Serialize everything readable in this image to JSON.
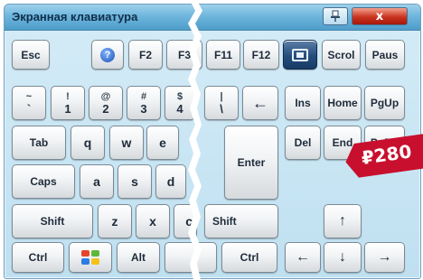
{
  "window": {
    "title": "Экранная клавиатура"
  },
  "titlebar": {
    "close_glyph": "x"
  },
  "keys": {
    "row1": [
      {
        "label": "Esc",
        "name": "key-esc"
      },
      {
        "label": "F2",
        "name": "key-f2"
      },
      {
        "label": "F3",
        "name": "key-f3"
      },
      {
        "label": "F11",
        "name": "key-f11"
      },
      {
        "label": "F12",
        "name": "key-f12"
      },
      {
        "label": "Scrol",
        "name": "key-scroll-lock"
      },
      {
        "label": "Paus",
        "name": "key-pause"
      }
    ],
    "row2": [
      {
        "top": "~",
        "bot": "`",
        "name": "key-backtick"
      },
      {
        "top": "!",
        "bot": "1",
        "name": "key-1"
      },
      {
        "top": "@",
        "bot": "2",
        "name": "key-2"
      },
      {
        "top": "#",
        "bot": "3",
        "name": "key-3"
      },
      {
        "top": "$",
        "bot": "4",
        "name": "key-4"
      },
      {
        "top": "|",
        "bot": "\\",
        "name": "key-backslash"
      },
      {
        "label": "←",
        "name": "key-backspace"
      },
      {
        "label": "Ins",
        "name": "key-insert"
      },
      {
        "label": "Home",
        "name": "key-home"
      },
      {
        "label": "PgUp",
        "name": "key-page-up"
      }
    ],
    "row3": [
      {
        "label": "Tab",
        "name": "key-tab"
      },
      {
        "label": "q",
        "name": "key-q"
      },
      {
        "label": "w",
        "name": "key-w"
      },
      {
        "label": "e",
        "name": "key-e"
      },
      {
        "label": "Del",
        "name": "key-delete"
      },
      {
        "label": "End",
        "name": "key-end"
      },
      {
        "label": "PgDn",
        "name": "key-page-down"
      }
    ],
    "row4": [
      {
        "label": "Caps",
        "name": "key-caps-lock"
      },
      {
        "label": "a",
        "name": "key-a"
      },
      {
        "label": "s",
        "name": "key-s"
      },
      {
        "label": "d",
        "name": "key-d"
      },
      {
        "label": "Enter",
        "name": "key-enter"
      }
    ],
    "row5": [
      {
        "label": "Shift",
        "name": "key-shift-left"
      },
      {
        "label": "z",
        "name": "key-z"
      },
      {
        "label": "x",
        "name": "key-x"
      },
      {
        "label": "c",
        "name": "key-c"
      },
      {
        "label": "Shift",
        "name": "key-shift-right"
      },
      {
        "label": "↑",
        "name": "key-arrow-up"
      }
    ],
    "row6": [
      {
        "label": "Ctrl",
        "name": "key-ctrl-left"
      },
      {
        "label": "Alt",
        "name": "key-alt"
      },
      {
        "label": "Ctrl",
        "name": "key-ctrl-right"
      },
      {
        "label": "←",
        "name": "key-arrow-left"
      },
      {
        "label": "↓",
        "name": "key-arrow-down"
      },
      {
        "label": "→",
        "name": "key-arrow-right"
      }
    ]
  },
  "icons": {
    "pin": "pin-icon",
    "close": "close-icon",
    "help": "help-icon",
    "screenshot": "screenshot-icon",
    "windows": "windows-logo-icon",
    "help_glyph": "?"
  },
  "price_tag": {
    "text": "₽280",
    "color": "#c8102e"
  },
  "colors": {
    "key_face": "#f1f3f5",
    "accent_key": "#244d7d",
    "window_bg": "#cfe8f5"
  }
}
